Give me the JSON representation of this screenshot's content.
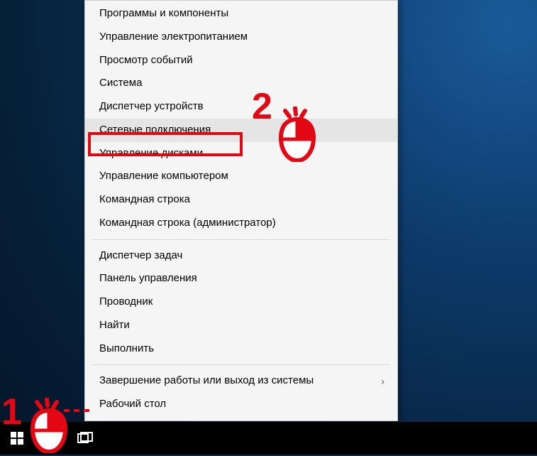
{
  "menu": {
    "items": [
      {
        "label": "Программы и компоненты",
        "sep": false,
        "submenu": false,
        "hovered": false
      },
      {
        "label": "Управление электропитанием",
        "sep": false,
        "submenu": false,
        "hovered": false
      },
      {
        "label": "Просмотр событий",
        "sep": false,
        "submenu": false,
        "hovered": false
      },
      {
        "label": "Система",
        "sep": false,
        "submenu": false,
        "hovered": false
      },
      {
        "label": "Диспетчер устройств",
        "sep": false,
        "submenu": false,
        "hovered": false
      },
      {
        "label": "Сетевые подключения",
        "sep": false,
        "submenu": false,
        "hovered": true
      },
      {
        "label": "Управление дисками",
        "sep": false,
        "submenu": false,
        "hovered": false
      },
      {
        "label": "Управление компьютером",
        "sep": false,
        "submenu": false,
        "hovered": false
      },
      {
        "label": "Командная строка",
        "sep": false,
        "submenu": false,
        "hovered": false
      },
      {
        "label": "Командная строка (администратор)",
        "sep": false,
        "submenu": false,
        "hovered": false
      },
      {
        "sep": true
      },
      {
        "label": "Диспетчер задач",
        "sep": false,
        "submenu": false,
        "hovered": false
      },
      {
        "label": "Панель управления",
        "sep": false,
        "submenu": false,
        "hovered": false
      },
      {
        "label": "Проводник",
        "sep": false,
        "submenu": false,
        "hovered": false
      },
      {
        "label": "Найти",
        "sep": false,
        "submenu": false,
        "hovered": false
      },
      {
        "label": "Выполнить",
        "sep": false,
        "submenu": false,
        "hovered": false
      },
      {
        "sep": true
      },
      {
        "label": "Завершение работы или выход из системы",
        "sep": false,
        "submenu": true,
        "hovered": false
      },
      {
        "label": "Рабочий стол",
        "sep": false,
        "submenu": false,
        "hovered": false
      }
    ]
  },
  "annotations": {
    "label1": "1",
    "label2": "2",
    "color": "#e30613"
  }
}
